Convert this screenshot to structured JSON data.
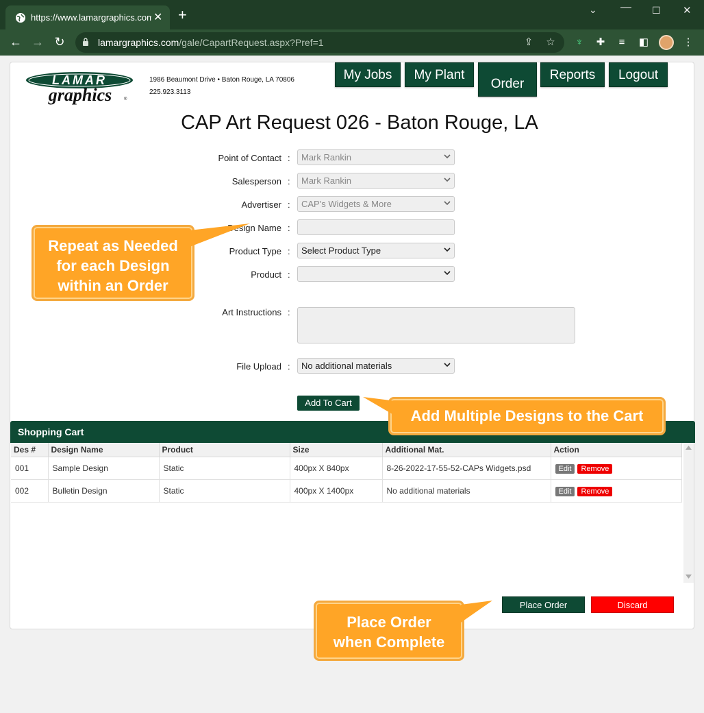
{
  "browser": {
    "tab_title": "https://www.lamargraphics.com/g",
    "url_host": "lamargraphics.com",
    "url_path": "/gale/CapartRequest.aspx?Pref=1"
  },
  "header": {
    "logo_text_1": "LAMAR",
    "logo_text_2": "graphics",
    "address_line": "1986 Beaumont Drive  •  Baton Rouge, LA 70806",
    "phone": "225.923.3113",
    "nav": [
      {
        "label": "My Jobs"
      },
      {
        "label": "My Plant"
      },
      {
        "label": "Order"
      },
      {
        "label": "Reports"
      },
      {
        "label": "Logout"
      }
    ]
  },
  "page_title": "CAP Art Request 026 - Baton Rouge, LA",
  "form": {
    "point_of_contact": {
      "label": "Point of Contact",
      "value": "Mark Rankin"
    },
    "salesperson": {
      "label": "Salesperson",
      "value": "Mark Rankin"
    },
    "advertiser": {
      "label": "Advertiser",
      "value": "CAP's Widgets & More"
    },
    "design_name": {
      "label": "Design Name",
      "value": ""
    },
    "product_type": {
      "label": "Product Type",
      "value": "Select Product Type"
    },
    "product": {
      "label": "Product",
      "value": ""
    },
    "art_instructions": {
      "label": "Art Instructions",
      "value": ""
    },
    "file_upload": {
      "label": "File Upload",
      "value": "No additional materials"
    },
    "colon": ":",
    "add_to_cart": "Add To Cart"
  },
  "cart": {
    "title": "Shopping Cart",
    "columns": [
      "Des #",
      "Design Name",
      "Product",
      "Size",
      "Additional Mat.",
      "Action"
    ],
    "rows": [
      {
        "des": "001",
        "name": "Sample Design",
        "product": "Static",
        "size": "400px X 840px",
        "additional": "8-26-2022-17-55-52-CAPs Widgets.psd"
      },
      {
        "des": "002",
        "name": "Bulletin Design",
        "product": "Static",
        "size": "400px X 1400px",
        "additional": "No additional materials"
      }
    ],
    "edit_label": "Edit",
    "remove_label": "Remove"
  },
  "actions": {
    "place_order": "Place Order",
    "discard": "Discard"
  },
  "callouts": {
    "repeat": [
      "Repeat as Needed",
      "for each Design",
      "within an Order"
    ],
    "add_multiple": "Add Multiple Designs to the Cart",
    "place_order": [
      "Place Order",
      "when Complete"
    ]
  },
  "colors": {
    "brand_green": "#0e4a34",
    "browser_frame": "#1f3d26",
    "callout_orange": "#ffa526",
    "remove_red": "#ee0000"
  }
}
